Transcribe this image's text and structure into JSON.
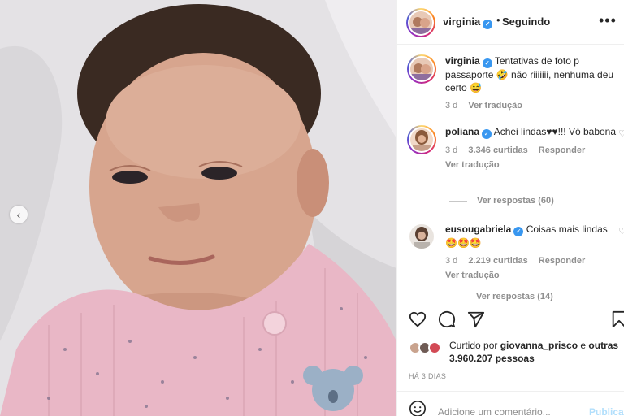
{
  "post": {
    "username": "virginia",
    "follow_status": "Seguindo",
    "separator": "•",
    "more_icon": "more-horizontal-icon"
  },
  "photo": {
    "description_icon": "photo-carousel",
    "prev_icon": "chevron-left-icon",
    "prev_glyph": "‹"
  },
  "comments": [
    {
      "username": "virginia",
      "text": "Tentativas de foto p passaporte 🤣 não riiiiiii, nenhuma deu certo 😅",
      "time": "3 d",
      "translate": "Ver tradução"
    },
    {
      "username": "poliana",
      "text": "Achei lindas♥♥!!! Vó babona",
      "time": "3 d",
      "likes": "3.346 curtidas",
      "reply": "Responder",
      "translate": "Ver tradução",
      "view_replies": "Ver respostas (60)"
    },
    {
      "username": "eusougabriela",
      "text": "Coisas mais lindas 🤩🤩🤩",
      "time": "3 d",
      "likes": "2.219 curtidas",
      "reply": "Responder",
      "translate": "Ver tradução",
      "view_replies": "Ver respostas (14)"
    }
  ],
  "actions": {
    "like_icon": "heart-icon",
    "comment_icon": "comment-icon",
    "share_icon": "send-icon",
    "save_icon": "bookmark-icon"
  },
  "likes": {
    "prefix": "Curtido por ",
    "user": "giovanna_prisco",
    "middle": " e ",
    "others": "outras 3.960.207 pessoas"
  },
  "date": "HÁ 3 DIAS",
  "add_comment": {
    "placeholder": "Adicione um comentário...",
    "publish": "Publicar",
    "emoji_icon": "smiley-icon"
  },
  "colors": {
    "verified": "#3897f0",
    "link_disabled": "#b2dffc",
    "secondary_text": "#8e8e8e"
  }
}
